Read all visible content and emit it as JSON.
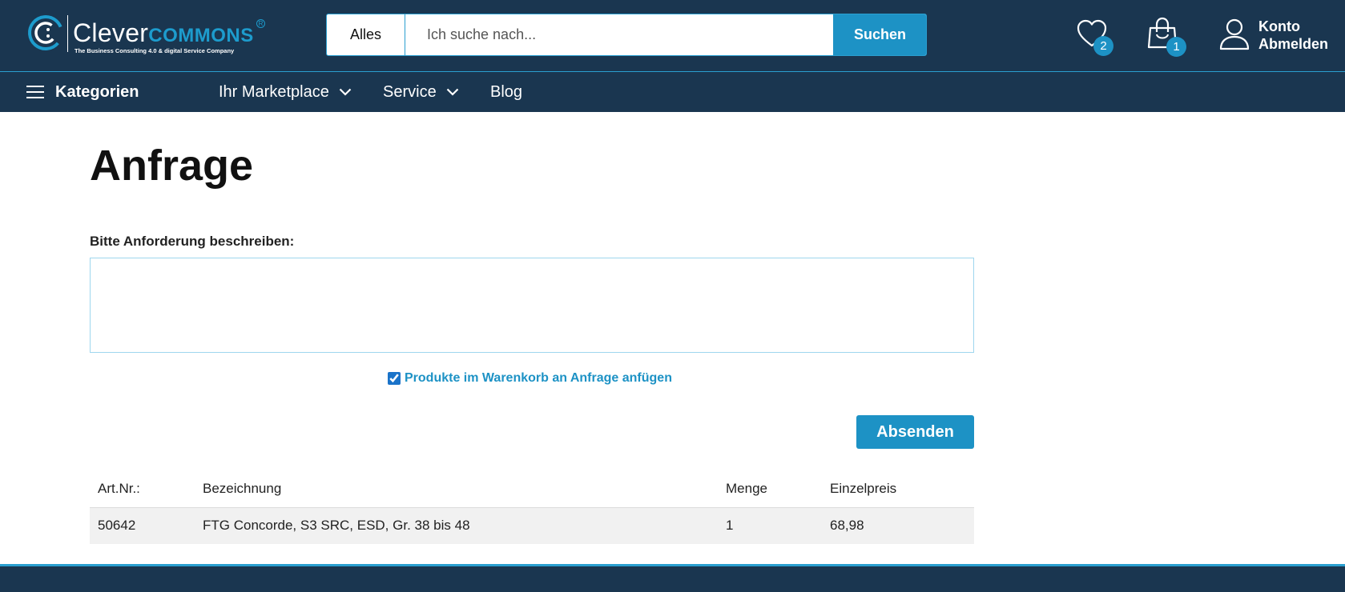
{
  "brand": {
    "name_part1": "Clever",
    "name_part2": "COMMONS",
    "registered": "R",
    "tagline": "The Business Consulting 4.0 & digital Service Company",
    "accent_color": "#1d9ccd"
  },
  "header": {
    "background_color": "#1a3650",
    "search": {
      "scope": "Alles",
      "placeholder": "Ich suche nach...",
      "value": "",
      "button_label": "Suchen"
    },
    "wishlist": {
      "icon": "heart-icon",
      "count": "2"
    },
    "cart": {
      "icon": "shopping-bag-icon",
      "count": "1"
    },
    "account": {
      "icon": "user-icon",
      "account_label": "Konto",
      "logout_label": "Abmelden"
    }
  },
  "nav": {
    "categories_label": "Kategorien",
    "items": [
      {
        "label": "Ihr Marketplace",
        "has_dropdown": true
      },
      {
        "label": "Service",
        "has_dropdown": true
      },
      {
        "label": "Blog",
        "has_dropdown": false
      }
    ]
  },
  "main": {
    "title": "Anfrage",
    "description_label": "Bitte Anforderung beschreiben:",
    "description_value": "",
    "attach_checkbox": {
      "label": "Produkte im Warenkorb an Anfrage anfügen",
      "checked": true
    },
    "submit_label": "Absenden",
    "table": {
      "headers": [
        "Art.Nr.:",
        "Bezeichnung",
        "Menge",
        "Einzelpreis"
      ],
      "rows": [
        [
          "50642",
          "FTG Concorde, S3 SRC, ESD, Gr. 38 bis 48",
          "1",
          "68,98"
        ]
      ]
    }
  },
  "colors": {
    "primary": "#1d92c5",
    "header_bg": "#1a3650",
    "row_bg": "#f1f1f1"
  }
}
